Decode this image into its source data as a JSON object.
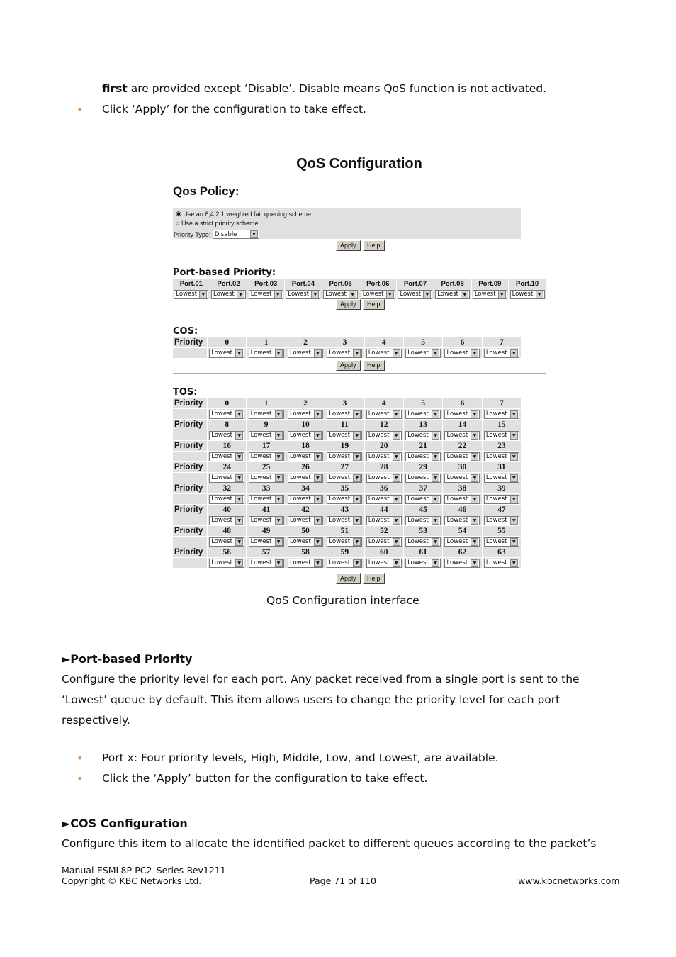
{
  "intro": {
    "bold": "first",
    "rest": " are provided except ‘Disable’. Disable means QoS function is not activated.",
    "bullet": "Click ‘Apply’ for the configuration to take effect."
  },
  "ui": {
    "title": "QoS Configuration",
    "policy_label": "Qos Policy:",
    "radio1": "Use an 8,4,2,1 weighted fair queuing scheme",
    "radio1_checked": true,
    "radio2": "Use a strict priority scheme",
    "priority_type_label": "Priority Type:",
    "priority_type_value": "Disable",
    "apply": "Apply",
    "help": "Help",
    "port_label": "Port-based Priority:",
    "ports": [
      "Port.01",
      "Port.02",
      "Port.03",
      "Port.04",
      "Port.05",
      "Port.06",
      "Port.07",
      "Port.08",
      "Port.09",
      "Port.10"
    ],
    "default_value": "Lowest",
    "cos_label": "COS:",
    "priority_header": "Priority",
    "cos_values": [
      "0",
      "1",
      "2",
      "3",
      "4",
      "5",
      "6",
      "7"
    ],
    "tos_label": "TOS:",
    "tos_rows": [
      [
        "0",
        "1",
        "2",
        "3",
        "4",
        "5",
        "6",
        "7"
      ],
      [
        "8",
        "9",
        "10",
        "11",
        "12",
        "13",
        "14",
        "15"
      ],
      [
        "16",
        "17",
        "18",
        "19",
        "20",
        "21",
        "22",
        "23"
      ],
      [
        "24",
        "25",
        "26",
        "27",
        "28",
        "29",
        "30",
        "31"
      ],
      [
        "32",
        "33",
        "34",
        "35",
        "36",
        "37",
        "38",
        "39"
      ],
      [
        "40",
        "41",
        "42",
        "43",
        "44",
        "45",
        "46",
        "47"
      ],
      [
        "48",
        "49",
        "50",
        "51",
        "52",
        "53",
        "54",
        "55"
      ],
      [
        "56",
        "57",
        "58",
        "59",
        "60",
        "61",
        "62",
        "63"
      ]
    ]
  },
  "caption": "QoS Configuration interface",
  "sec1": {
    "title": "►Port-based Priority",
    "p1": "Configure the priority level for each port. Any packet received from a single port is sent to the",
    "p2": "‘Lowest’ queue by default. This item allows users to change the priority level for each port",
    "p3": "respectively.",
    "b1": "Port x: Four priority levels, High, Middle, Low, and Lowest, are available.",
    "b2": "Click the ‘Apply’ button for the configuration to take effect."
  },
  "sec2": {
    "title": "►COS Configuration",
    "p1": "Configure this item to allocate the identified packet to different queues according to the packet’s"
  },
  "footer": {
    "manual": "Manual-ESML8P-PC2_Series-Rev1211",
    "copyright": "Copyright © KBC Networks Ltd.",
    "page": "Page 71 of 110",
    "site": "www.kbcnetworks.com"
  },
  "colors": {
    "bullet": "#f08a24",
    "panel": "#e0e0e0"
  }
}
